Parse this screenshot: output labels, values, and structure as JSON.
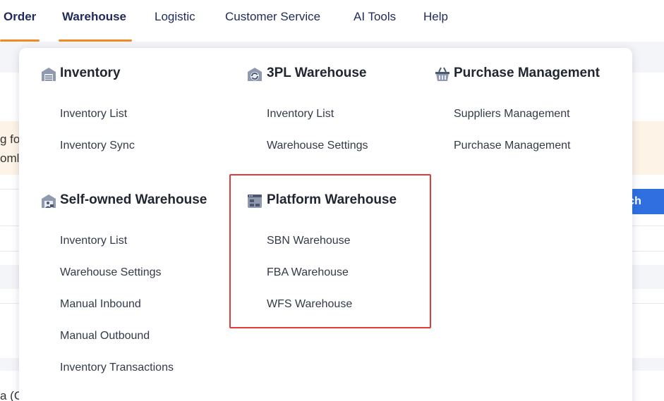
{
  "topnav": {
    "items": [
      {
        "label": "Order"
      },
      {
        "label": "Warehouse"
      },
      {
        "label": "Logistic"
      },
      {
        "label": "Customer Service"
      },
      {
        "label": "AI Tools"
      },
      {
        "label": "Help"
      }
    ],
    "active": "Warehouse",
    "accent_color": "#f08a24"
  },
  "background": {
    "warning_line1": "g fo",
    "warning_line2": "oml",
    "search_label": "rch",
    "bottom_text": "a (C"
  },
  "dropdown": {
    "sections": [
      {
        "title": "Inventory",
        "icon": "warehouse-icon",
        "links": [
          "Inventory List",
          "Inventory Sync"
        ]
      },
      {
        "title": "3PL Warehouse",
        "icon": "3pl-warehouse-icon",
        "links": [
          "Inventory List",
          "Warehouse Settings"
        ]
      },
      {
        "title": "Purchase Management",
        "icon": "purchase-basket-icon",
        "links": [
          "Suppliers Management",
          "Purchase Management"
        ]
      },
      {
        "title": "Self-owned Warehouse",
        "icon": "self-owned-warehouse-icon",
        "links": [
          "Inventory List",
          "Warehouse Settings",
          "Manual Inbound",
          "Manual Outbound",
          "Inventory Transactions"
        ]
      },
      {
        "title": "Platform Warehouse",
        "icon": "platform-warehouse-icon",
        "links": [
          "SBN Warehouse",
          "FBA Warehouse",
          "WFS Warehouse"
        ]
      }
    ],
    "highlight_color": "#e23b3b"
  }
}
